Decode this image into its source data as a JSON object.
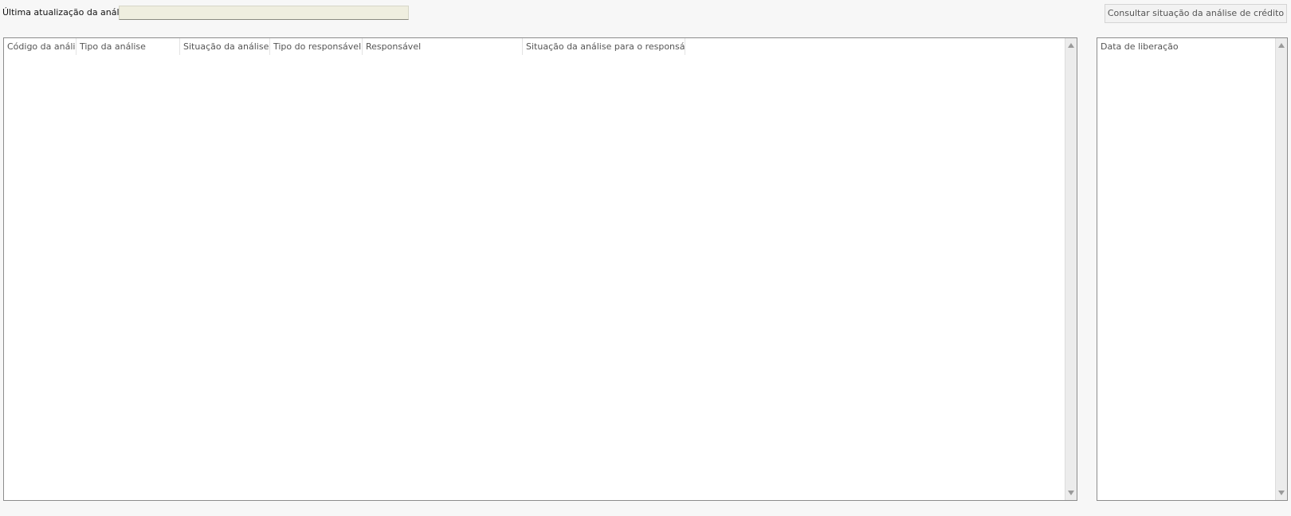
{
  "header": {
    "last_update_label": "Última atualização da análise:",
    "last_update_value": "",
    "consult_button": "Consultar situação da análise de crédito"
  },
  "main_grid": {
    "columns": [
      "Código da análise",
      "Tipo da análise",
      "Situação da análise",
      "Tipo do responsável",
      "Responsável",
      "Situação da análise para o responsável"
    ],
    "rows": []
  },
  "side_grid": {
    "columns": [
      "Data de liberação"
    ],
    "rows": []
  },
  "icons": {
    "scroll_up": "triangle-up-icon",
    "scroll_down": "triangle-down-icon"
  }
}
